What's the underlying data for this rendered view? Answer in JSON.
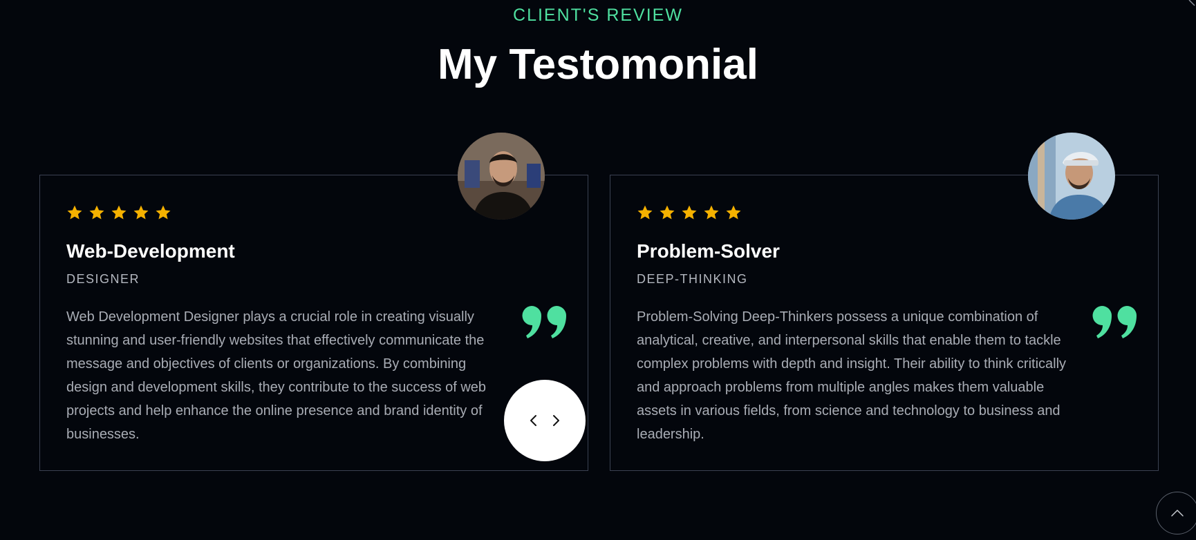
{
  "section": {
    "eyebrow": "CLIENT'S REVIEW",
    "title": "My Testomonial"
  },
  "testimonials": [
    {
      "rating": 5,
      "title": "Web-Development",
      "subtitle": "DESIGNER",
      "text": "Web Development Designer plays a crucial role in creating visually stunning and user-friendly websites that effectively communicate the message and objectives of clients or organizations. By combining design and development skills, they contribute to the success of web projects and help enhance the online presence and brand identity of businesses.",
      "avatar_icon": "avatar-photo"
    },
    {
      "rating": 5,
      "title": "Problem-Solver",
      "subtitle": "DEEP-THINKING",
      "text": "Problem-Solving Deep-Thinkers possess a unique combination of analytical, creative, and interpersonal skills that enable them to tackle complex problems with depth and insight. Their ability to think critically and approach problems from multiple angles makes them valuable assets in various fields, from science and technology to business and leadership.",
      "avatar_icon": "avatar-photo"
    }
  ],
  "icons": {
    "star": "star-icon",
    "quote": "quote-icon",
    "prev": "chevron-left-icon",
    "next": "chevron-right-icon",
    "scroll_top": "chevron-up-icon"
  },
  "colors": {
    "background": "#03060c",
    "accent": "#4fe0a0",
    "star": "#f5b100",
    "card_border": "#3b4252",
    "body_text": "#a9adb5"
  }
}
